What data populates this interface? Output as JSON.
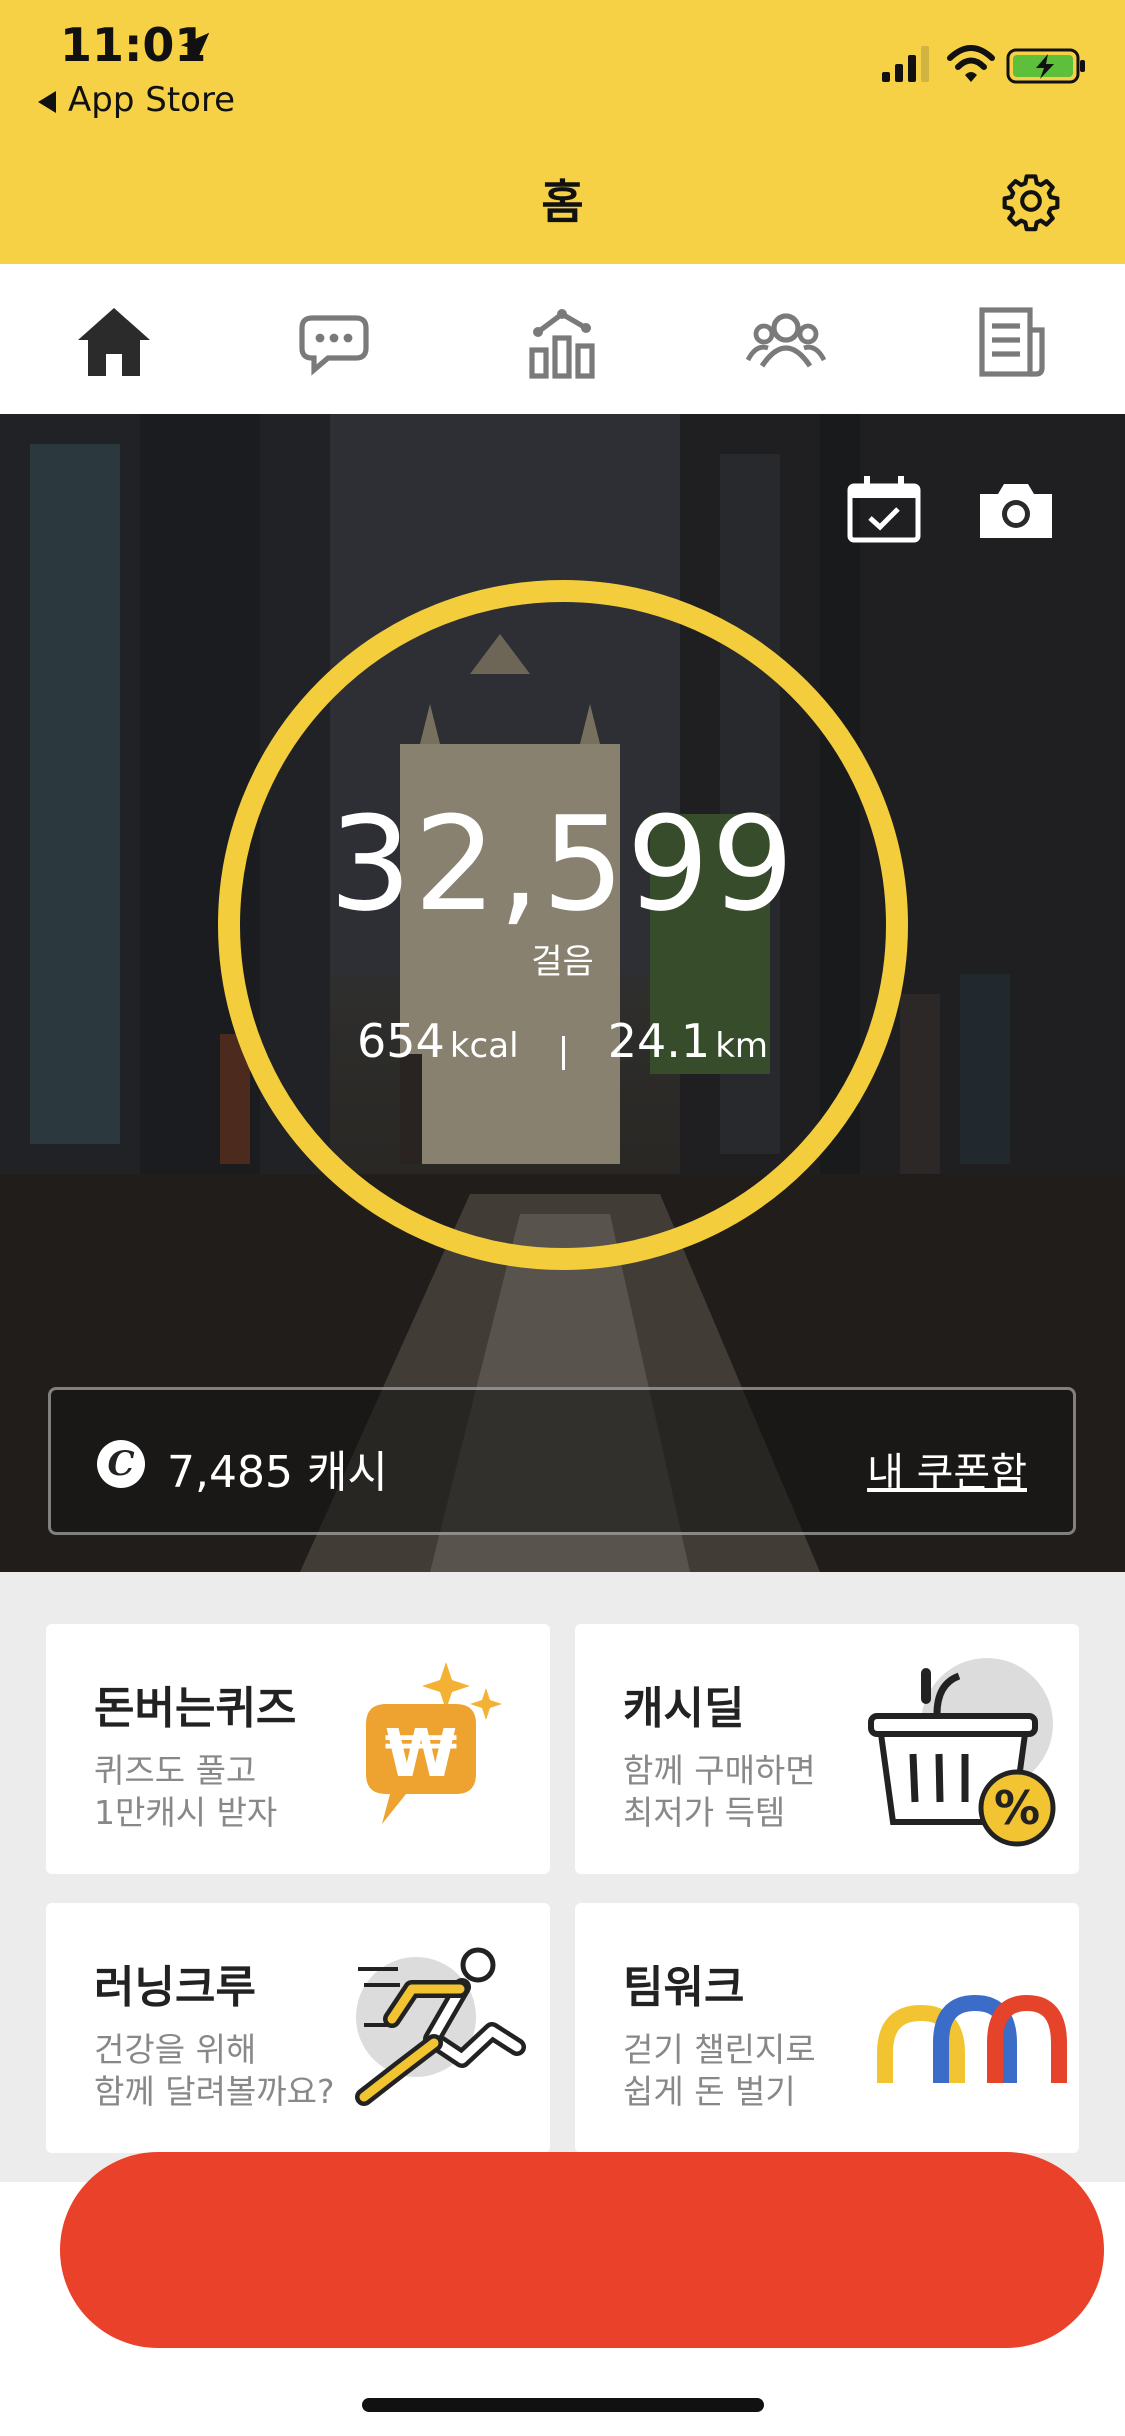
{
  "status_bar": {
    "time": "11:01",
    "back_label": "App Store"
  },
  "header": {
    "title": "홈"
  },
  "tabs": [
    {
      "icon": "home-icon"
    },
    {
      "icon": "chat-icon"
    },
    {
      "icon": "stats-chart-icon"
    },
    {
      "icon": "friends-icon"
    },
    {
      "icon": "news-icon"
    }
  ],
  "hero": {
    "steps": "32,599",
    "steps_label": "걸음",
    "kcal_value": "654",
    "kcal_unit": "kcal",
    "km_value": "24.1",
    "km_unit": "km"
  },
  "cash": {
    "icon_letter": "C",
    "amount": "7,485 캐시",
    "coupon_link": "내 쿠폰함"
  },
  "cards": [
    {
      "title": "돈버는퀴즈",
      "line1": "퀴즈도 풀고",
      "line2": "1만캐시 받자"
    },
    {
      "title": "캐시딜",
      "line1": "함께 구매하면",
      "line2": "최저가 득템"
    },
    {
      "title": "러닝크루",
      "line1": "건강을 위해",
      "line2": "함께 달려볼까요?"
    },
    {
      "title": "팀워크",
      "line1": "걷기 챌린지로",
      "line2": "쉽게 돈 벌기"
    }
  ],
  "colors": {
    "brand_yellow": "#f6d145",
    "ring": "#f4cd3c",
    "banner_red": "#e9412a"
  }
}
